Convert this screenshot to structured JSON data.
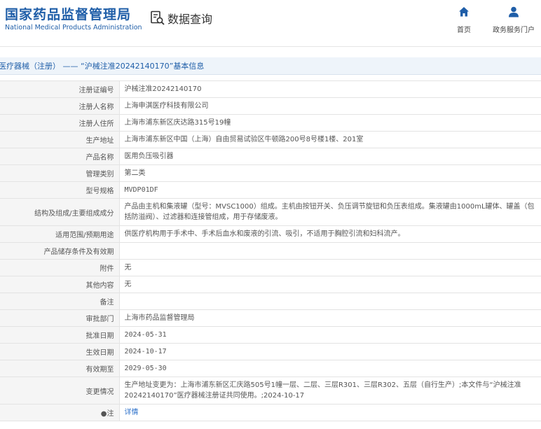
{
  "header": {
    "logo_cn": "国家药品监督管理局",
    "logo_en": "National Medical Products Administration",
    "query_label": "数据查询",
    "nav": {
      "home_label": "首页",
      "gov_label": "政务服务门户"
    },
    "colors": {
      "brand": "#1f5ea8",
      "title_bg": "#eef4fa"
    }
  },
  "title_bar": {
    "text": "医疗器械（注册） —— “沪械注准20242140170”基本信息"
  },
  "rows": [
    {
      "key": "注册证编号",
      "value": "沪械注准20242140170"
    },
    {
      "key": "注册人名称",
      "value": "上海申淇医疗科技有限公司"
    },
    {
      "key": "注册人住所",
      "value": "上海市浦东新区庆达路315号19幢"
    },
    {
      "key": "生产地址",
      "value": "上海市浦东新区中国（上海）自由贸易试验区牛顿路200号8号楼1楼、201室"
    },
    {
      "key": "产品名称",
      "value": "医用负压吸引器"
    },
    {
      "key": "管理类别",
      "value": "第二类"
    },
    {
      "key": "型号规格",
      "value": "MVDP01DF"
    },
    {
      "key": "结构及组成/主要组成成分",
      "value": "产品由主机和集液罐（型号：MVSC1000）组成。主机由按钮开关、负压调节旋钮和负压表组成。集液罐由1000mL罐体、罐盖（包括防溢阀）、过滤器和连接管组成，用于存储废液。"
    },
    {
      "key": "适用范围/预期用途",
      "value": "供医疗机构用于手术中、手术后血水和废液的引流、吸引，不适用于胸腔引流和妇科流产。"
    },
    {
      "key": "产品储存条件及有效期",
      "value": ""
    },
    {
      "key": "附件",
      "value": "无"
    },
    {
      "key": "其他内容",
      "value": "无"
    },
    {
      "key": "备注",
      "value": ""
    },
    {
      "key": "审批部门",
      "value": "上海市药品监督管理局"
    },
    {
      "key": "批准日期",
      "value": "2024-05-31"
    },
    {
      "key": "生效日期",
      "value": "2024-10-17"
    },
    {
      "key": "有效期至",
      "value": "2029-05-30"
    },
    {
      "key": "变更情况",
      "value": "生产地址变更为：上海市浦东新区汇庆路505号1幢一层、二层、三层R301、三层R302、五层（自行生产）;本文件与“沪械注准20242140170”医疗器械注册证共同使用。;2024-10-17"
    },
    {
      "key": "●注",
      "value": "详情"
    }
  ]
}
